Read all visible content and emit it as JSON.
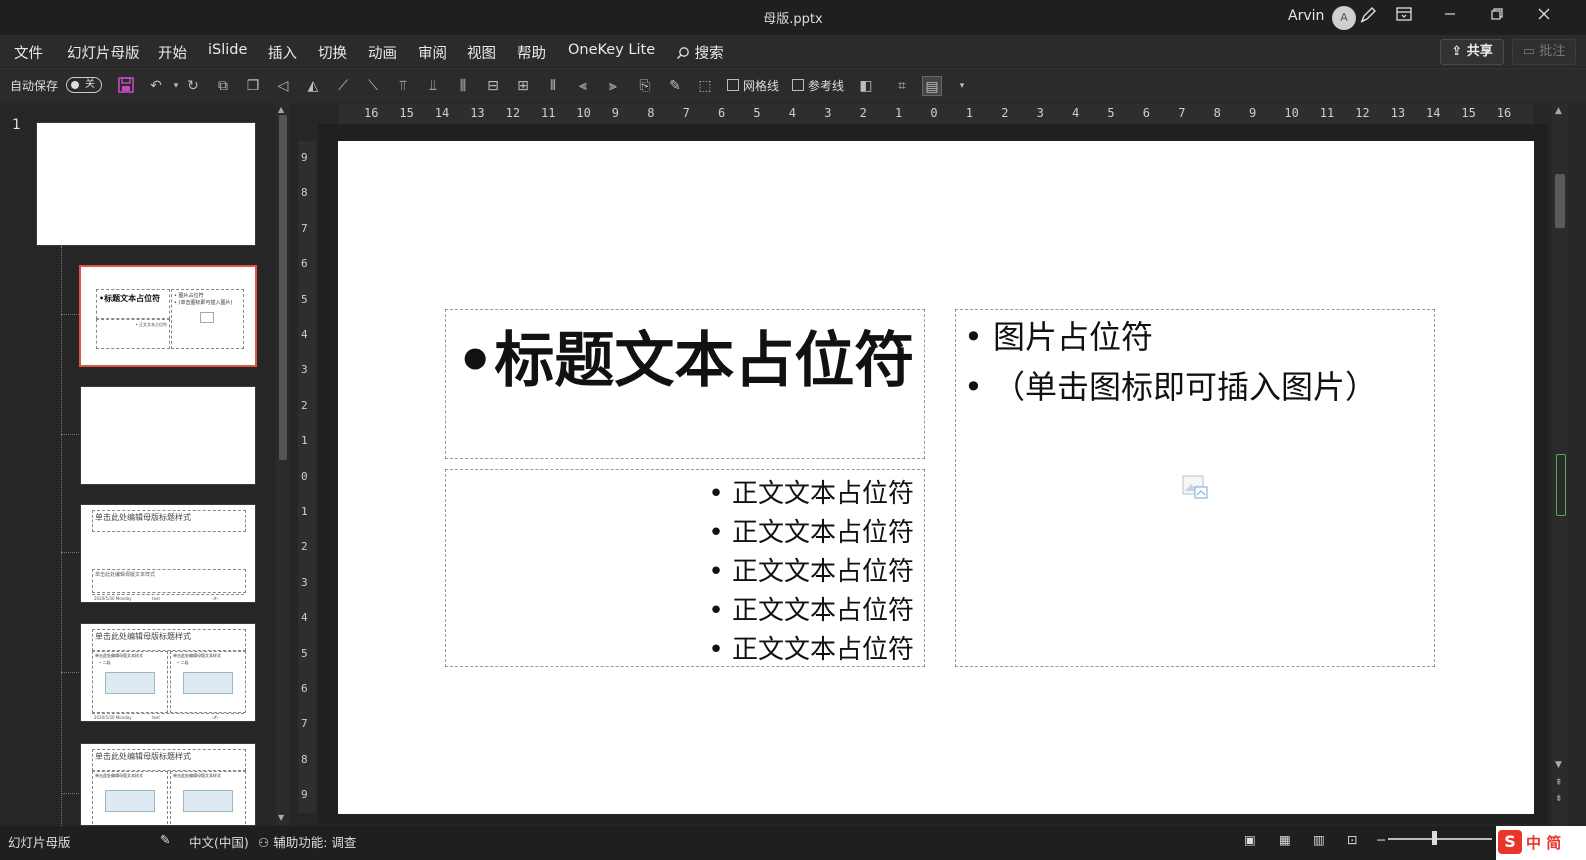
{
  "window": {
    "title": "母版.pptx",
    "user_name": "Arvin",
    "avatar_initial": "A",
    "icons": [
      "pen-icon",
      "ribbon-display-icon",
      "minimize-icon",
      "restore-icon",
      "close-icon"
    ]
  },
  "menu": {
    "items": [
      "文件",
      "幻灯片母版",
      "开始",
      "iSlide",
      "插入",
      "切换",
      "动画",
      "审阅",
      "视图",
      "帮助",
      "OneKey Lite"
    ],
    "search_label": "搜索",
    "share_label": "共享",
    "comment_label": "批注"
  },
  "toolbar": {
    "autosave_label": "自动保存",
    "autosave_state": "关",
    "gridlines_label": "网格线",
    "guides_label": "参考线"
  },
  "panel": {
    "slide_number": "1",
    "thumb2": {
      "title": "•标题文本占位符",
      "pic_line1": "• 图片占位符",
      "pic_line2": "• (单击图标即可插入图片)",
      "body_line": "• 正文文本占位符"
    },
    "thumb_layout_title": "单击此处编辑母版标题样式",
    "thumb_layout_body": "单击此处编辑母版文本样式",
    "thumb_layout_body2": "单击此处编辑母版文本样式",
    "thumb_footer_date": "2020/5/30 Monday",
    "thumb_footer_text": "text",
    "thumb_footer_num": "‹#›",
    "thumb_sub1": "• 二级",
    "thumb_sub2": "• 三级"
  },
  "ruler": {
    "h_ticks": [
      "16",
      "15",
      "14",
      "13",
      "12",
      "11",
      "10",
      "9",
      "8",
      "7",
      "6",
      "5",
      "4",
      "3",
      "2",
      "1",
      "0",
      "1",
      "2",
      "3",
      "4",
      "5",
      "6",
      "7",
      "8",
      "9",
      "10",
      "11",
      "12",
      "13",
      "14",
      "15",
      "16"
    ],
    "v_ticks": [
      "9",
      "8",
      "7",
      "6",
      "5",
      "4",
      "3",
      "2",
      "1",
      "0",
      "1",
      "2",
      "3",
      "4",
      "5",
      "6",
      "7",
      "8",
      "9"
    ]
  },
  "slide": {
    "title_placeholder": "•标题文本占位符",
    "body_lines": [
      "•  正文文本占位符",
      "•  正文文本占位符",
      "•  正文文本占位符",
      "•  正文文本占位符",
      "•  正文文本占位符"
    ],
    "pic_line1": "• 图片占位符",
    "pic_line2": "• （单击图标即可插入图片）"
  },
  "status": {
    "view_name": "幻灯片母版",
    "language": "中文(中国)",
    "accessibility": "辅助功能: 调查",
    "ime_text": "中 简"
  },
  "colors": {
    "selected_border": "#e0583b",
    "save_icon": "#c34bbf"
  }
}
